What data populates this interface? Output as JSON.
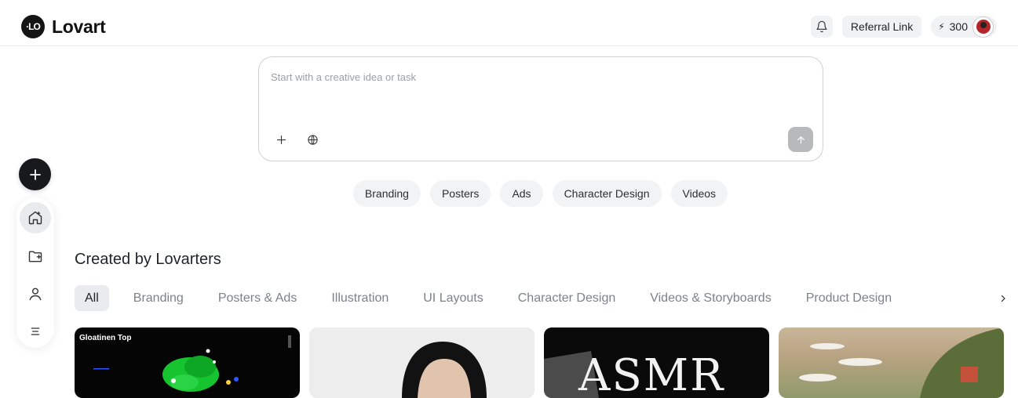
{
  "header": {
    "brand": "Lovart",
    "logo_mark": "·LO",
    "referral_label": "Referral Link",
    "credits": "300",
    "icons": {
      "bell": "bell-icon",
      "bolt": "bolt-icon",
      "avatar": "avatar"
    }
  },
  "sidebar": {
    "new_icon": "plus-icon",
    "items": [
      {
        "name": "home",
        "icon": "home-icon",
        "active": true
      },
      {
        "name": "projects",
        "icon": "folder-plus-icon",
        "active": false
      },
      {
        "name": "profile",
        "icon": "user-icon",
        "active": false
      },
      {
        "name": "menu",
        "icon": "menu-icon",
        "active": false
      }
    ]
  },
  "prompt": {
    "placeholder": "Start with a creative idea or task",
    "value": "",
    "icons": [
      "plus-icon",
      "globe-icon",
      "arrow-up-icon"
    ]
  },
  "chips": [
    "Branding",
    "Posters",
    "Ads",
    "Character Design",
    "Videos"
  ],
  "gallery": {
    "title": "Created by Lovarters",
    "filters": [
      "All",
      "Branding",
      "Posters & Ads",
      "Illustration",
      "UI Layouts",
      "Character Design",
      "Videos & Storyboards",
      "Product Design"
    ],
    "active_filter": "All",
    "cards": [
      {
        "label": "Gloatinen Top"
      },
      {
        "label": ""
      },
      {
        "label": "ASMR"
      },
      {
        "label": ""
      }
    ]
  },
  "colors": {
    "accent_dark": "#17191c",
    "chip_bg": "#f2f3f5",
    "send_disabled": "#b8b9bb"
  }
}
